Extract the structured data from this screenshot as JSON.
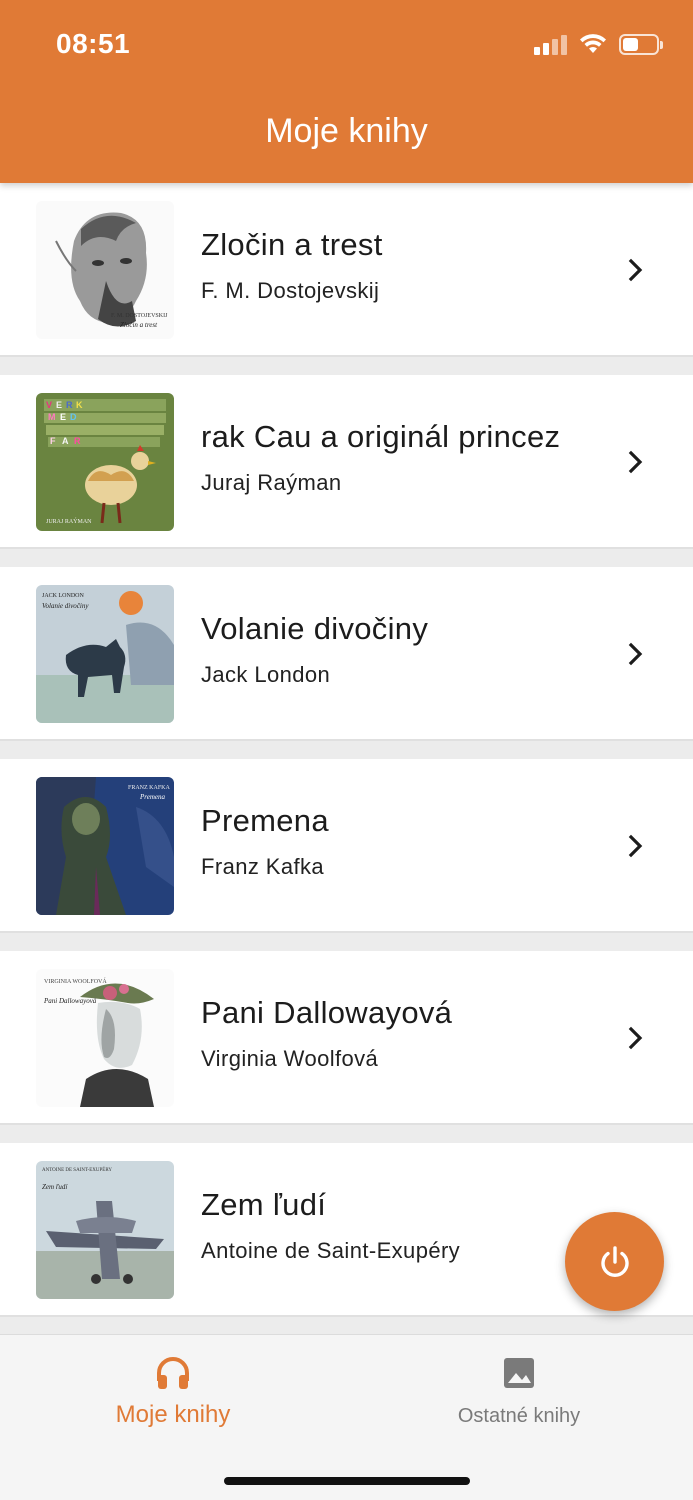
{
  "status_bar": {
    "time": "08:51"
  },
  "header": {
    "title": "Moje knihy"
  },
  "books": [
    {
      "title": "Zločin a trest",
      "author": "F. M. Dostojevskij",
      "cover_caption": "Zločin a trest"
    },
    {
      "title": "rak Cau a originál princez",
      "author": "Juraj Raýman",
      "cover_caption": "JURAJ RAÝMAN"
    },
    {
      "title": "Volanie divočiny",
      "author": "Jack London",
      "cover_caption": "Volanie divočiny",
      "cover_author": "JACK LONDON"
    },
    {
      "title": "Premena",
      "author": "Franz Kafka",
      "cover_caption": "Premena",
      "cover_author": "FRANZ KAFKA"
    },
    {
      "title": "Pani Dallowayová",
      "author": "Virginia Woolfová",
      "cover_caption": "Pani Dallowayová",
      "cover_author": "VIRGINIA WOOLFOVÁ"
    },
    {
      "title": "Zem ľudí",
      "author": "Antoine de Saint-Exupéry",
      "cover_caption": "Zem ľudí",
      "cover_author": "ANTOINE DE SAINT-EXUPÉRY"
    }
  ],
  "fab": {
    "icon": "power-icon"
  },
  "bottom_nav": {
    "items": [
      {
        "label": "Moje knihy",
        "icon": "headphones-icon",
        "active": true
      },
      {
        "label": "Ostatné knihy",
        "icon": "image-icon",
        "active": false
      }
    ]
  },
  "colors": {
    "accent": "#e07a36",
    "inactive": "#7a7a7a"
  }
}
